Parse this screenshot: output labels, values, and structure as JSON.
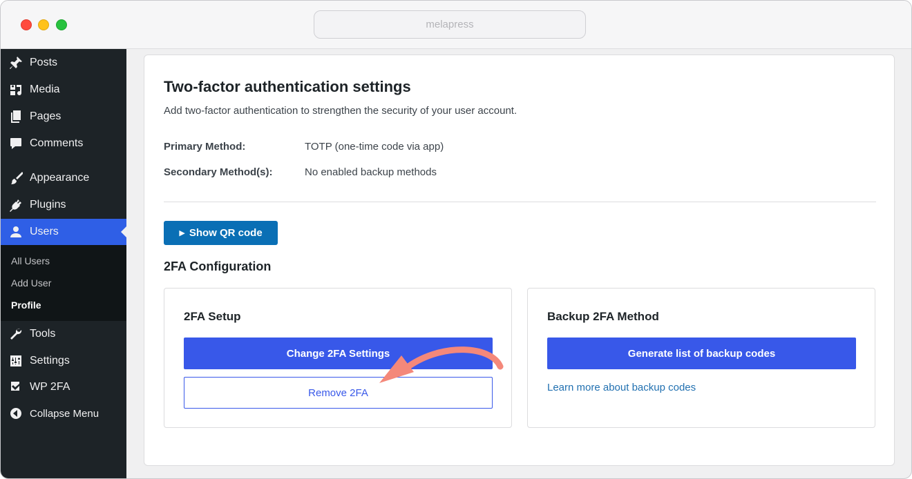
{
  "browser": {
    "url": "melapress"
  },
  "sidebar": {
    "items": [
      {
        "label": "Posts",
        "icon": "pin-icon"
      },
      {
        "label": "Media",
        "icon": "media-icon"
      },
      {
        "label": "Pages",
        "icon": "pages-icon"
      },
      {
        "label": "Comments",
        "icon": "comment-icon"
      },
      {
        "label": "Appearance",
        "icon": "brush-icon"
      },
      {
        "label": "Plugins",
        "icon": "plug-icon"
      },
      {
        "label": "Users",
        "icon": "user-icon",
        "active": true
      },
      {
        "label": "Tools",
        "icon": "wrench-icon"
      },
      {
        "label": "Settings",
        "icon": "settings-sliders-icon"
      },
      {
        "label": "WP 2FA",
        "icon": "wp2fa-icon"
      },
      {
        "label": "Collapse Menu",
        "icon": "collapse-icon"
      }
    ],
    "submenu": [
      {
        "label": "All Users"
      },
      {
        "label": "Add User"
      },
      {
        "label": "Profile",
        "current": true
      }
    ]
  },
  "main": {
    "title": "Two-factor authentication settings",
    "subtitle": "Add two-factor authentication to strengthen the security of your user account.",
    "primary_method_label": "Primary Method:",
    "primary_method_value": "TOTP (one-time code via app)",
    "secondary_method_label": "Secondary Method(s):",
    "secondary_method_value": "No enabled backup methods",
    "show_qr_label": "Show QR code",
    "config_title": "2FA Configuration",
    "setup_box": {
      "title": "2FA Setup",
      "change_button": "Change 2FA Settings",
      "remove_button": "Remove 2FA"
    },
    "backup_box": {
      "title": "Backup 2FA Method",
      "generate_button": "Generate list of backup codes",
      "learn_more_link": "Learn more about backup codes"
    }
  },
  "colors": {
    "sidebar_bg": "#1d2327",
    "active_menu": "#2f5fe6",
    "primary_button": "#3858e9",
    "qr_button": "#0a6fb5",
    "link": "#2271b1",
    "annotation_arrow": "#f4887a"
  }
}
